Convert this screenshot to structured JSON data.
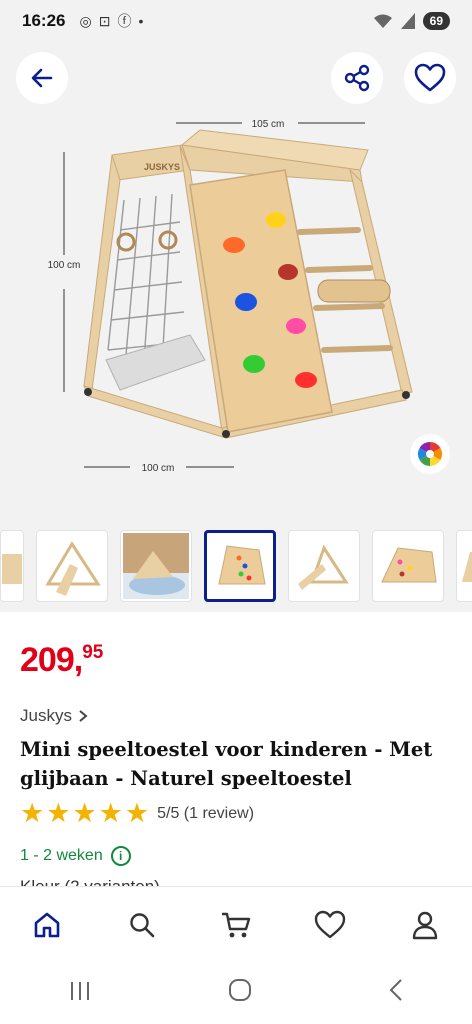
{
  "status": {
    "time": "16:26",
    "battery": "69"
  },
  "product_image": {
    "brand_mark": "JUSKYS",
    "dim_width": "105 cm",
    "dim_height": "100 cm",
    "dim_depth": "100 cm"
  },
  "price": {
    "whole": "209,",
    "fraction": "95"
  },
  "product": {
    "brand": "Juskys",
    "title": "Mini speeltoestel voor kinderen - Met glijbaan - Naturel speeltoestel",
    "rating_text": "5/5 (1 review)",
    "stars": 5,
    "delivery": "1 - 2 weken",
    "colour_label": "Kleur (2 varianten)"
  },
  "colors": {
    "accent": "#0b1e8c",
    "price": "#e0001a",
    "stars": "#f5b301",
    "delivery": "#118a3c"
  }
}
